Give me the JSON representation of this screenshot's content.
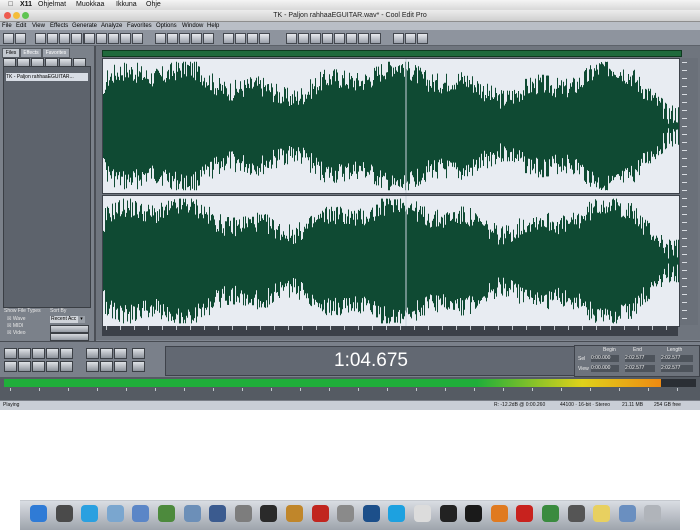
{
  "mac_menu": {
    "apple": "",
    "app": "X11",
    "items": [
      "Ohjelmat",
      "Muokkaa",
      "Ikkuna",
      "Ohje"
    ]
  },
  "window": {
    "title": "TK - Paljon rahhaaEGUITAR.wav* - Cool Edit Pro",
    "menu": [
      "File",
      "Edit",
      "View",
      "Effects",
      "Generate",
      "Analyze",
      "Favorites",
      "Options",
      "Window",
      "Help"
    ]
  },
  "left_panel": {
    "tabs": [
      "Files",
      "Effects",
      "Favorites"
    ],
    "file_item": "TK - Paljon rahhaaEGUITAR...",
    "show_file_types_label": "Show File Types",
    "sort_by_label": "Sort By",
    "file_types": [
      "Wave",
      "MIDI",
      "Video"
    ],
    "sort_value": "Recent Acc"
  },
  "time_display": "1:04.675",
  "selection": {
    "headers": [
      "Begin",
      "End",
      "Length"
    ],
    "rows": [
      {
        "label": "Sel",
        "begin": "0:00.000",
        "end": "2:02.577",
        "length": "2:02.577"
      },
      {
        "label": "View",
        "begin": "0:00.000",
        "end": "2:02.577",
        "length": "2:02.577"
      }
    ]
  },
  "status": {
    "state": "Playing",
    "level": "R: -12.2dB @ 0:00.260",
    "format": "44100 · 16-bit · Stereo",
    "size": "21.11 MB",
    "free": "254 GB free"
  },
  "colors": {
    "waveform": "#0f4a33",
    "wave_bg": "#e8ecf2",
    "overview": "#1f6a3c",
    "level_green": "#1fae3a",
    "level_yellow": "#e0d21a",
    "level_orange": "#ee8a12"
  },
  "level_meter_fraction": 0.95,
  "dock_icons": [
    "finder-icon",
    "dashboard-icon",
    "safari-icon",
    "mail-icon",
    "itunes-icon",
    "iphoto-icon",
    "preview-icon",
    "time-machine-icon",
    "system-preferences-icon",
    "activity-monitor-icon",
    "garageband-icon",
    "filezilla-icon",
    "utilities-icon",
    "photoshop-icon",
    "skype-icon",
    "textedit-icon",
    "terminal-icon",
    "x11-icon",
    "firefox-icon",
    "opera-icon",
    "chrome-icon",
    "console-icon",
    "stickies-icon",
    "downloads-icon",
    "trash-icon"
  ]
}
